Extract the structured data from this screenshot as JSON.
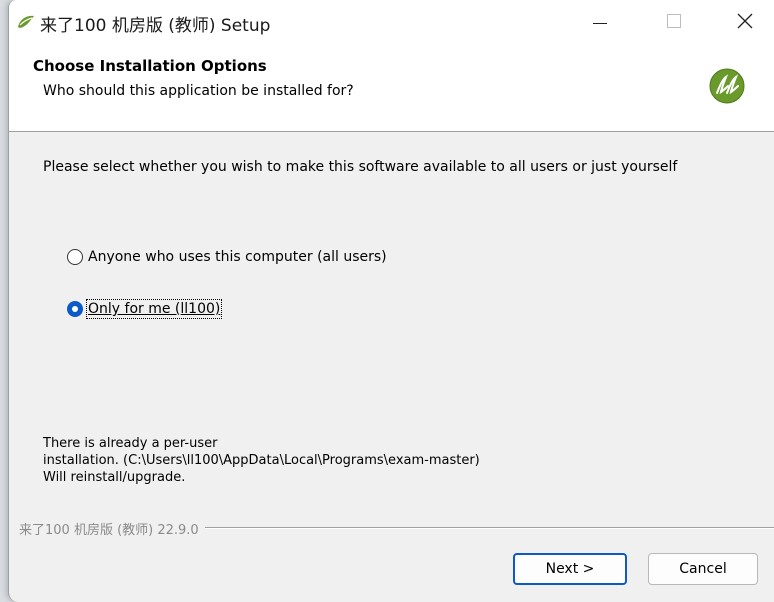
{
  "window": {
    "title": "来了100 机房版 (教师) Setup"
  },
  "header": {
    "title": "Choose Installation Options",
    "subtitle": "Who should this application be installed for?"
  },
  "main": {
    "prompt": "Please select whether you wish to make this software available to all users or just yourself",
    "options": [
      {
        "label": "Anyone who uses this computer (all users)",
        "checked": false
      },
      {
        "label": "Only for me (ll100)",
        "checked": true
      }
    ],
    "info_lines": [
      "There is already a per-user",
      "installation. (C:\\Users\\ll100\\AppData\\Local\\Programs\\exam-master)",
      "Will reinstall/upgrade."
    ]
  },
  "footer": {
    "brand": "来了100 机房版 (教师) 22.9.0",
    "next_label": "Next >",
    "cancel_label": "Cancel"
  },
  "colors": {
    "accent": "#0c59c8",
    "logo_green": "#6a9a2c"
  }
}
